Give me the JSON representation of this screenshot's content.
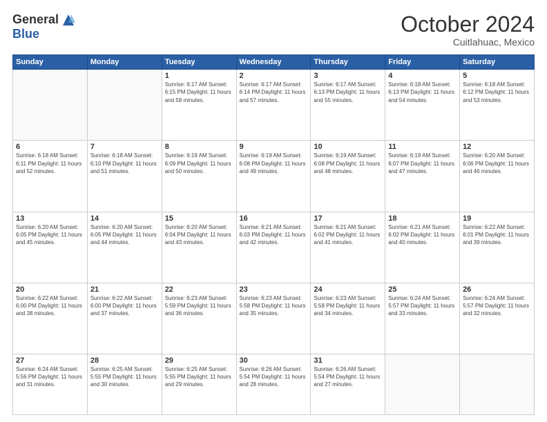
{
  "header": {
    "logo_general": "General",
    "logo_blue": "Blue",
    "month_title": "October 2024",
    "location": "Cuitlahuac, Mexico"
  },
  "weekdays": [
    "Sunday",
    "Monday",
    "Tuesday",
    "Wednesday",
    "Thursday",
    "Friday",
    "Saturday"
  ],
  "weeks": [
    [
      {
        "day": "",
        "info": ""
      },
      {
        "day": "",
        "info": ""
      },
      {
        "day": "1",
        "info": "Sunrise: 6:17 AM\nSunset: 6:15 PM\nDaylight: 11 hours\nand 58 minutes."
      },
      {
        "day": "2",
        "info": "Sunrise: 6:17 AM\nSunset: 6:14 PM\nDaylight: 11 hours\nand 57 minutes."
      },
      {
        "day": "3",
        "info": "Sunrise: 6:17 AM\nSunset: 6:13 PM\nDaylight: 11 hours\nand 55 minutes."
      },
      {
        "day": "4",
        "info": "Sunrise: 6:18 AM\nSunset: 6:13 PM\nDaylight: 11 hours\nand 54 minutes."
      },
      {
        "day": "5",
        "info": "Sunrise: 6:18 AM\nSunset: 6:12 PM\nDaylight: 11 hours\nand 53 minutes."
      }
    ],
    [
      {
        "day": "6",
        "info": "Sunrise: 6:18 AM\nSunset: 6:11 PM\nDaylight: 11 hours\nand 52 minutes."
      },
      {
        "day": "7",
        "info": "Sunrise: 6:18 AM\nSunset: 6:10 PM\nDaylight: 11 hours\nand 51 minutes."
      },
      {
        "day": "8",
        "info": "Sunrise: 6:19 AM\nSunset: 6:09 PM\nDaylight: 11 hours\nand 50 minutes."
      },
      {
        "day": "9",
        "info": "Sunrise: 6:19 AM\nSunset: 6:08 PM\nDaylight: 11 hours\nand 49 minutes."
      },
      {
        "day": "10",
        "info": "Sunrise: 6:19 AM\nSunset: 6:08 PM\nDaylight: 11 hours\nand 48 minutes."
      },
      {
        "day": "11",
        "info": "Sunrise: 6:19 AM\nSunset: 6:07 PM\nDaylight: 11 hours\nand 47 minutes."
      },
      {
        "day": "12",
        "info": "Sunrise: 6:20 AM\nSunset: 6:06 PM\nDaylight: 11 hours\nand 46 minutes."
      }
    ],
    [
      {
        "day": "13",
        "info": "Sunrise: 6:20 AM\nSunset: 6:05 PM\nDaylight: 11 hours\nand 45 minutes."
      },
      {
        "day": "14",
        "info": "Sunrise: 6:20 AM\nSunset: 6:05 PM\nDaylight: 11 hours\nand 44 minutes."
      },
      {
        "day": "15",
        "info": "Sunrise: 6:20 AM\nSunset: 6:04 PM\nDaylight: 11 hours\nand 43 minutes."
      },
      {
        "day": "16",
        "info": "Sunrise: 6:21 AM\nSunset: 6:03 PM\nDaylight: 11 hours\nand 42 minutes."
      },
      {
        "day": "17",
        "info": "Sunrise: 6:21 AM\nSunset: 6:02 PM\nDaylight: 11 hours\nand 41 minutes."
      },
      {
        "day": "18",
        "info": "Sunrise: 6:21 AM\nSunset: 6:02 PM\nDaylight: 11 hours\nand 40 minutes."
      },
      {
        "day": "19",
        "info": "Sunrise: 6:22 AM\nSunset: 6:01 PM\nDaylight: 11 hours\nand 39 minutes."
      }
    ],
    [
      {
        "day": "20",
        "info": "Sunrise: 6:22 AM\nSunset: 6:00 PM\nDaylight: 11 hours\nand 38 minutes."
      },
      {
        "day": "21",
        "info": "Sunrise: 6:22 AM\nSunset: 6:00 PM\nDaylight: 11 hours\nand 37 minutes."
      },
      {
        "day": "22",
        "info": "Sunrise: 6:23 AM\nSunset: 5:59 PM\nDaylight: 11 hours\nand 36 minutes."
      },
      {
        "day": "23",
        "info": "Sunrise: 6:23 AM\nSunset: 5:58 PM\nDaylight: 11 hours\nand 35 minutes."
      },
      {
        "day": "24",
        "info": "Sunrise: 6:23 AM\nSunset: 5:58 PM\nDaylight: 11 hours\nand 34 minutes."
      },
      {
        "day": "25",
        "info": "Sunrise: 6:24 AM\nSunset: 5:57 PM\nDaylight: 11 hours\nand 33 minutes."
      },
      {
        "day": "26",
        "info": "Sunrise: 6:24 AM\nSunset: 5:57 PM\nDaylight: 11 hours\nand 32 minutes."
      }
    ],
    [
      {
        "day": "27",
        "info": "Sunrise: 6:24 AM\nSunset: 5:56 PM\nDaylight: 11 hours\nand 31 minutes."
      },
      {
        "day": "28",
        "info": "Sunrise: 6:25 AM\nSunset: 5:55 PM\nDaylight: 11 hours\nand 30 minutes."
      },
      {
        "day": "29",
        "info": "Sunrise: 6:25 AM\nSunset: 5:55 PM\nDaylight: 11 hours\nand 29 minutes."
      },
      {
        "day": "30",
        "info": "Sunrise: 6:26 AM\nSunset: 5:54 PM\nDaylight: 11 hours\nand 28 minutes."
      },
      {
        "day": "31",
        "info": "Sunrise: 6:26 AM\nSunset: 5:54 PM\nDaylight: 11 hours\nand 27 minutes."
      },
      {
        "day": "",
        "info": ""
      },
      {
        "day": "",
        "info": ""
      }
    ]
  ]
}
